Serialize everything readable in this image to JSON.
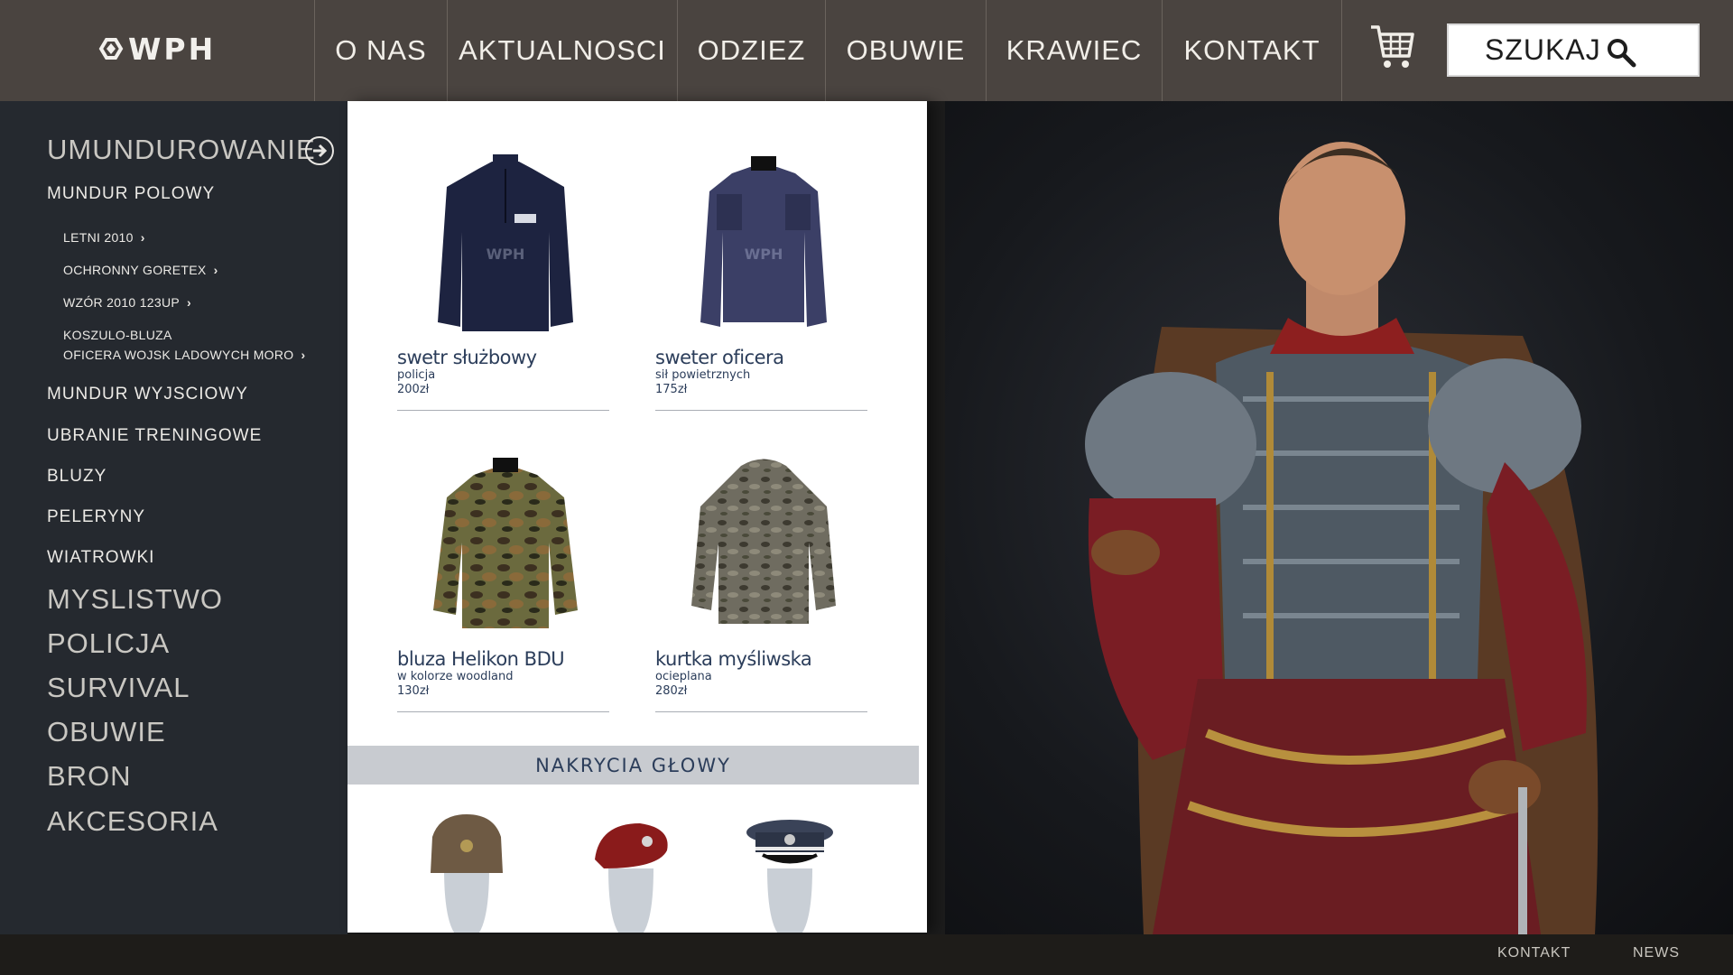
{
  "brand": {
    "logo_text": "WPH"
  },
  "nav": {
    "items": [
      "O NAS",
      "AKTUALNOSCI",
      "ODZIEZ",
      "OBUWIE",
      "KRAWIEC",
      "KONTAKT"
    ],
    "search_label": "SZUKAJ",
    "cart_icon": "cart-icon",
    "search_icon": "search-icon"
  },
  "sidebar": {
    "main_category": "UMUNDUROWANIE",
    "sub_category": "MUNDUR POLOWY",
    "subsub": [
      "LETNI 2010",
      "OCHRONNY GORETEX",
      "WZÓR 2010 123UP"
    ],
    "subsub_multiline": {
      "line1": "KOSZULO-BLUZA",
      "line2": "OFICERA WOJSK LADOWYCH MORO"
    },
    "other_subs": [
      "MUNDUR WYJSCIOWY",
      "UBRANIE TRENINGOWE",
      "BLUZY",
      "PELERYNY",
      "WIATROWKI"
    ],
    "other_mains": [
      "MYSLISTWO",
      "POLICJA",
      "SURVIVAL",
      "OBUWIE",
      "BRON",
      "AKCESORIA"
    ]
  },
  "products": [
    {
      "name": "swetr służbowy",
      "sub": "policja",
      "price": "200zł"
    },
    {
      "name": "sweter oficera",
      "sub": "sił powietrznych",
      "price": "175zł"
    },
    {
      "name": "bluza Helikon BDU",
      "sub": "w kolorze woodland",
      "price": "130zł"
    },
    {
      "name": "kurtka myśliwska",
      "sub": "ocieplana",
      "price": "280zł"
    }
  ],
  "section": {
    "title": "NAKRYCIA GŁOWY"
  },
  "footer": {
    "links": [
      "KONTAKT",
      "NEWS"
    ]
  },
  "colors": {
    "topbar": "#4a4440",
    "sidebar": "#25292f",
    "product_text": "#2b3d5a",
    "footer": "#1e1c19"
  }
}
